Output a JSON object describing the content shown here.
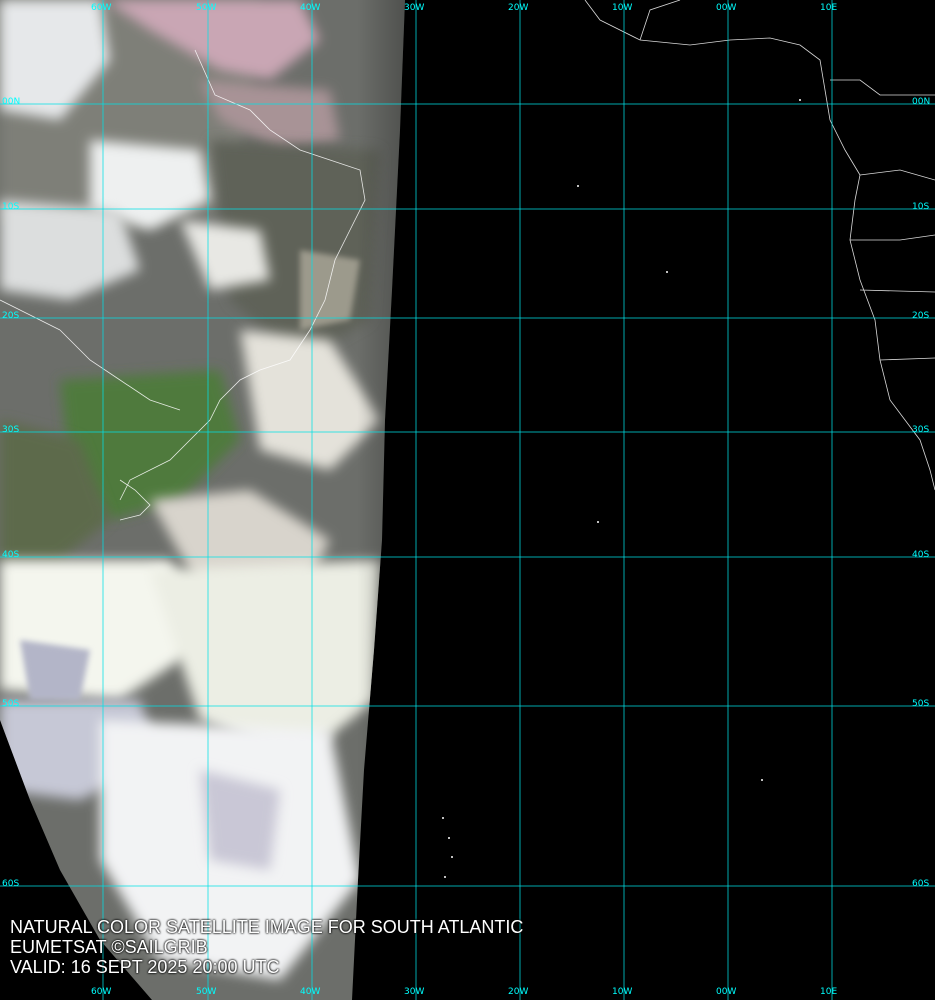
{
  "caption": {
    "line1": "NATURAL COLOR SATELLITE IMAGE FOR SOUTH ATLANTIC",
    "line2": "EUMETSAT ©SAILGRIB",
    "line3": "VALID:  16 SEPT 2025 20:00 UTC"
  },
  "colors": {
    "grid": "#00e0e6",
    "label": "#00ffff",
    "caption": "#ffffff",
    "coast": "#ffffff",
    "background": "#000000"
  },
  "grid": {
    "longitude_labels": [
      "60W",
      "50W",
      "40W",
      "30W",
      "20W",
      "10W",
      "00W",
      "10E"
    ],
    "latitude_labels": [
      "00N",
      "10S",
      "20S",
      "30S",
      "40S",
      "50S",
      "60S"
    ]
  }
}
